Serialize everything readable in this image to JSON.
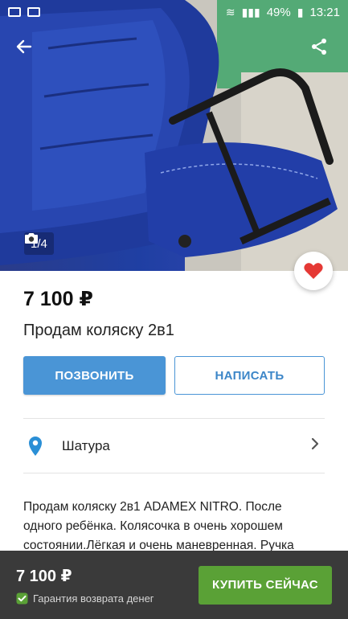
{
  "status_bar": {
    "battery": "49%",
    "time": "13:21"
  },
  "gallery": {
    "counter": "1/4",
    "icons": [
      "back-arrow-icon",
      "share-icon",
      "camera-icon",
      "heart-icon"
    ]
  },
  "listing": {
    "price": "7 100 ₽",
    "title": "Продам коляску 2в1",
    "call_label": "ПОЗВОНИТЬ",
    "write_label": "НАПИСАТЬ",
    "location": "Шатура",
    "description_lines": [
      "Продам коляску 2в1 ADAMEX NITRO. После",
      "одного ребёнка. Колясочка в очень хорошем",
      "состоянии.Лёгкая и очень маневренная. Ручка"
    ]
  },
  "bottom_bar": {
    "price": "7 100 ₽",
    "guarantee": "Гарантия возврата денег",
    "buy_label": "КУПИТЬ СЕЙЧАС"
  },
  "colors": {
    "primary_blue": "#4a95d6",
    "buy_green": "#5aa136",
    "heart_red": "#e53935",
    "pin_blue": "#2a8fd6",
    "bottom_bar": "#3a3a3a"
  }
}
